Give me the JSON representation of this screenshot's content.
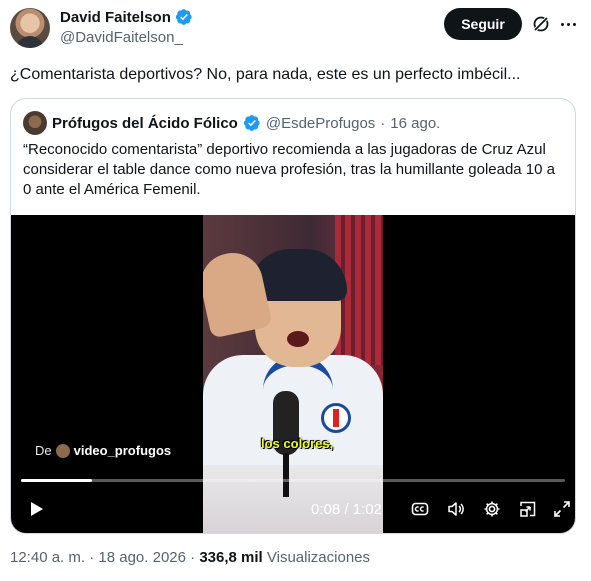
{
  "author": {
    "display_name": "David Faitelson",
    "handle": "@DavidFaitelson_"
  },
  "follow_label": "Seguir",
  "tweet_text": "¿Comentarista deportivos? No, para nada, este es un perfecto imbécil...",
  "quote": {
    "display_name": "Prófugos del Ácido Fólico",
    "handle": "@EsdeProfugos",
    "separator": "·",
    "date": "16 ago.",
    "text": "“Reconocido comentarista” deportivo recomienda a las jugadoras de Cruz Azul considerar el table dance como nueva profesión, tras la humillante goleada 10 a 0 ante el América Femenil."
  },
  "video": {
    "caption": "los colores,",
    "source_prefix": "De",
    "source_name": "video_profugos",
    "time": "0:08 / 1:02",
    "progress": 0.13
  },
  "footer": {
    "time": "12:40 a. m.",
    "separator": "·",
    "date": "18 ago. 2026",
    "views_count": "336,8 mil",
    "views_label": "Visualizaciones"
  },
  "colors": {
    "verified_blue": "#1d9bf0",
    "text_primary": "#0f1419",
    "text_secondary": "#536471",
    "caption_yellow": "#f0ff2a"
  },
  "icons": [
    "verified-badge-icon",
    "grok-icon",
    "more-icon",
    "play-icon",
    "captions-icon",
    "volume-icon",
    "settings-icon",
    "picture-in-picture-icon",
    "fullscreen-icon"
  ]
}
